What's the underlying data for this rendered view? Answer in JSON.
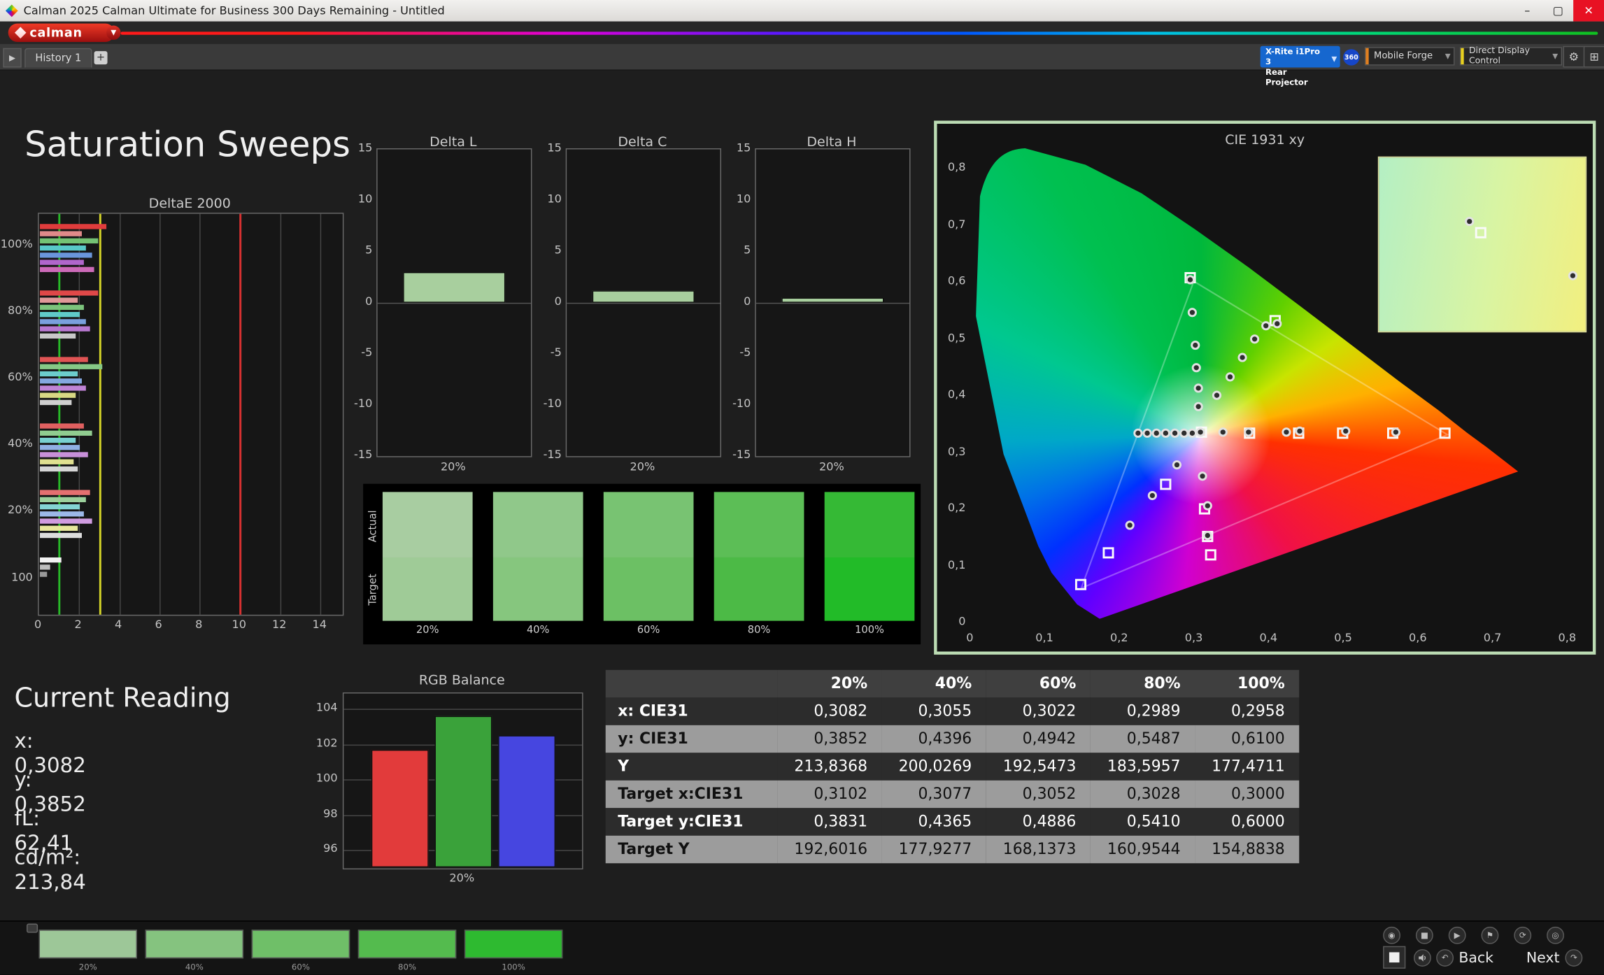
{
  "window": {
    "title": "Calman 2025 Calman Ultimate for Business 300 Days Remaining  - Untitled",
    "controls": {
      "minimize": "–",
      "maximize": "▢",
      "close": "✕"
    }
  },
  "brand": {
    "logo_text": "calman",
    "caret": "▼"
  },
  "toolbar": {
    "panel_toggle": "▶",
    "history_tab": "History 1",
    "add_tab": "+",
    "meter_line1": "X-Rite i1Pro 3",
    "meter_line2": "Rear Projector",
    "meter_caret": "▼",
    "badge": "360",
    "source_button": "Mobile Forge",
    "control_button": "Direct Display Control",
    "caret": "▼",
    "gear_glyph": "⚙",
    "layout_glyph": "⊞",
    "source_stripe_color": "#e08020",
    "control_stripe_color": "#e8d020"
  },
  "page": {
    "title": "Saturation Sweeps"
  },
  "chart_data": [
    {
      "type": "bar",
      "title": "DeltaE 2000",
      "orientation": "horizontal",
      "xlim": [
        0,
        15.1
      ],
      "x_ticks": [
        0,
        2,
        4,
        6,
        8,
        10,
        12,
        14
      ],
      "ref_lines": [
        {
          "color": "#28b828",
          "value": 1
        },
        {
          "color": "#d4d428",
          "value": 3.05
        },
        {
          "color": "#d83030",
          "value": 10
        }
      ],
      "groups": [
        {
          "label": "100%",
          "bars": [
            [
              "#e03c3c",
              3.3
            ],
            [
              "#e08a8a",
              2.1
            ],
            [
              "#74c274",
              2.9
            ],
            [
              "#58c8c8",
              2.3
            ],
            [
              "#6a96dc",
              2.6
            ],
            [
              "#b066cc",
              2.2
            ],
            [
              "#cc6ab8",
              2.7
            ]
          ]
        },
        {
          "label": "80%",
          "bars": [
            [
              "#e04848",
              2.9
            ],
            [
              "#e09898",
              1.9
            ],
            [
              "#7cc47c",
              2.2
            ],
            [
              "#60caca",
              2.0
            ],
            [
              "#7aa0de",
              2.3
            ],
            [
              "#b878d0",
              2.5
            ],
            [
              "#c8c8c8",
              1.8
            ]
          ]
        },
        {
          "label": "60%",
          "bars": [
            [
              "#e05454",
              2.4
            ],
            [
              "#86c886",
              3.1
            ],
            [
              "#6ccccc",
              1.9
            ],
            [
              "#84a8e0",
              2.1
            ],
            [
              "#c084d6",
              2.3
            ],
            [
              "#d8d884",
              1.8
            ],
            [
              "#cfcfcf",
              1.6
            ]
          ]
        },
        {
          "label": "40%",
          "bars": [
            [
              "#e06060",
              2.2
            ],
            [
              "#90cc90",
              2.6
            ],
            [
              "#78d0d0",
              1.8
            ],
            [
              "#90b0e4",
              2.0
            ],
            [
              "#c890da",
              2.4
            ],
            [
              "#e0e090",
              1.7
            ],
            [
              "#d6d6d6",
              1.9
            ]
          ]
        },
        {
          "label": "20%",
          "bars": [
            [
              "#e47070",
              2.5
            ],
            [
              "#9cd09c",
              2.3
            ],
            [
              "#84d4d4",
              2.0
            ],
            [
              "#9cb8e8",
              2.2
            ],
            [
              "#d09ce0",
              2.6
            ],
            [
              "#e8e89c",
              1.9
            ],
            [
              "#dddddd",
              2.1
            ]
          ]
        },
        {
          "label": "100",
          "bars": [
            [
              "#f2f2f2",
              1.05
            ],
            [
              "#bcbcbc",
              0.5
            ],
            [
              "#9a9a9a",
              0.35
            ]
          ]
        }
      ]
    },
    {
      "type": "bar",
      "title": "Delta L",
      "categories": [
        "20%"
      ],
      "values": [
        3.0
      ],
      "ylim": [
        -15,
        15
      ],
      "y_ticks": [
        15,
        10,
        5,
        0,
        -5,
        -10,
        -15
      ]
    },
    {
      "type": "bar",
      "title": "Delta C",
      "categories": [
        "20%"
      ],
      "values": [
        1.2
      ],
      "ylim": [
        -15,
        15
      ],
      "y_ticks": [
        15,
        10,
        5,
        0,
        -5,
        -10,
        -15
      ]
    },
    {
      "type": "bar",
      "title": "Delta H",
      "categories": [
        "20%"
      ],
      "values": [
        0.5
      ],
      "ylim": [
        -15,
        15
      ],
      "y_ticks": [
        15,
        10,
        5,
        0,
        -5,
        -10,
        -15
      ]
    },
    {
      "type": "scatter",
      "title": "CIE 1931 xy",
      "x_ticks": [
        "0",
        "0,1",
        "0,2",
        "0,3",
        "0,4",
        "0,5",
        "0,6",
        "0,7",
        "0,8"
      ],
      "y_ticks": [
        "0",
        "0,1",
        "0,2",
        "0,3",
        "0,4",
        "0,5",
        "0,6",
        "0,7",
        "0,8"
      ],
      "xlim": [
        0,
        0.8
      ],
      "ylim": [
        0,
        0.8
      ],
      "measured_points": [
        [
          0.225,
          0.333
        ],
        [
          0.2375,
          0.333
        ],
        [
          0.25,
          0.333
        ],
        [
          0.2625,
          0.333
        ],
        [
          0.275,
          0.333
        ],
        [
          0.2875,
          0.333
        ],
        [
          0.2985,
          0.333
        ],
        [
          0.309,
          0.3335
        ],
        [
          0.3395,
          0.334
        ],
        [
          0.3735,
          0.3345
        ],
        [
          0.4245,
          0.335
        ],
        [
          0.4415,
          0.3355
        ],
        [
          0.503,
          0.336
        ],
        [
          0.5705,
          0.3345
        ],
        [
          0.3065,
          0.379
        ],
        [
          0.3055,
          0.412
        ],
        [
          0.3035,
          0.447
        ],
        [
          0.3015,
          0.488
        ],
        [
          0.2985,
          0.545
        ],
        [
          0.2955,
          0.602
        ],
        [
          0.331,
          0.399
        ],
        [
          0.349,
          0.432
        ],
        [
          0.365,
          0.465
        ],
        [
          0.381,
          0.498
        ],
        [
          0.396,
          0.522
        ],
        [
          0.412,
          0.525
        ],
        [
          0.278,
          0.276
        ],
        [
          0.245,
          0.222
        ],
        [
          0.214,
          0.171
        ],
        [
          0.312,
          0.256
        ],
        [
          0.318,
          0.205
        ],
        [
          0.319,
          0.153
        ]
      ],
      "target_points": [
        [
          0.31,
          0.334
        ],
        [
          0.374,
          0.332
        ],
        [
          0.441,
          0.333
        ],
        [
          0.499,
          0.333
        ],
        [
          0.566,
          0.333
        ],
        [
          0.636,
          0.333
        ],
        [
          0.2955,
          0.607
        ],
        [
          0.409,
          0.53
        ],
        [
          0.262,
          0.243
        ],
        [
          0.185,
          0.121
        ],
        [
          0.149,
          0.065
        ],
        [
          0.315,
          0.2
        ],
        [
          0.319,
          0.15
        ],
        [
          0.322,
          0.118
        ]
      ],
      "inset_markers": [
        {
          "type": "circle",
          "x_pct": 44,
          "y_pct": 37
        },
        {
          "type": "square",
          "x_pct": 49,
          "y_pct": 43
        },
        {
          "type": "circle",
          "x_pct": 94,
          "y_pct": 68
        }
      ]
    },
    {
      "type": "bar",
      "title": "RGB Balance",
      "categories": [
        "20%"
      ],
      "series": [
        {
          "name": "Red",
          "color": "#e23b3b",
          "values": [
            101.7
          ]
        },
        {
          "name": "Green",
          "color": "#3aa23a",
          "values": [
            103.6
          ]
        },
        {
          "name": "Blue",
          "color": "#4646e0",
          "values": [
            102.5
          ]
        }
      ],
      "ylim": [
        96,
        104
      ],
      "y_ticks": [
        104,
        102,
        100,
        98,
        96
      ]
    }
  ],
  "swatch_panel": {
    "row_labels": [
      "Actual",
      "Target"
    ],
    "columns": [
      {
        "label": "20%",
        "actual": "#a8cda1",
        "target": "#9fcb97"
      },
      {
        "label": "40%",
        "actual": "#90c88a",
        "target": "#86c67e"
      },
      {
        "label": "60%",
        "actual": "#78c372",
        "target": "#6cc064"
      },
      {
        "label": "80%",
        "actual": "#5cbe56",
        "target": "#4cba46"
      },
      {
        "label": "100%",
        "actual": "#35b935",
        "target": "#22bb28"
      }
    ]
  },
  "current_reading": {
    "title": "Current Reading",
    "lines": [
      "x: 0,3082",
      "y: 0,3852",
      "fL: 62,41",
      "cd/m²: 213,84"
    ]
  },
  "results_table": {
    "columns": [
      "",
      "20%",
      "40%",
      "60%",
      "80%",
      "100%"
    ],
    "rows": [
      {
        "label": "x: CIE31",
        "values": [
          "0,3082",
          "0,3055",
          "0,3022",
          "0,2989",
          "0,2958"
        ]
      },
      {
        "label": "y: CIE31",
        "values": [
          "0,3852",
          "0,4396",
          "0,4942",
          "0,5487",
          "0,6100"
        ]
      },
      {
        "label": "Y",
        "values": [
          "213,8368",
          "200,0269",
          "192,5473",
          "183,5957",
          "177,4711"
        ]
      },
      {
        "label": "Target x:CIE31",
        "values": [
          "0,3102",
          "0,3077",
          "0,3052",
          "0,3028",
          "0,3000"
        ]
      },
      {
        "label": "Target y:CIE31",
        "values": [
          "0,3831",
          "0,4365",
          "0,4886",
          "0,5410",
          "0,6000"
        ]
      },
      {
        "label": "Target Y",
        "values": [
          "192,6016",
          "177,9277",
          "168,1373",
          "160,9544",
          "154,8838"
        ]
      }
    ]
  },
  "bottom": {
    "pattern_swatches": [
      {
        "label": "20%",
        "color": "#9dc798"
      },
      {
        "label": "40%",
        "color": "#85c37f"
      },
      {
        "label": "60%",
        "color": "#6fbf68"
      },
      {
        "label": "80%",
        "color": "#54bb4e"
      },
      {
        "label": "100%",
        "color": "#2eba30"
      }
    ],
    "transport_buttons": [
      {
        "name": "read-continuous-button",
        "glyph": "◉"
      },
      {
        "name": "stop-button",
        "glyph": "■"
      },
      {
        "name": "play-button",
        "glyph": "▶"
      },
      {
        "name": "flag-button",
        "glyph": "⚑"
      },
      {
        "name": "refresh-button",
        "glyph": "⟳"
      },
      {
        "name": "power-button",
        "glyph": "◎"
      }
    ],
    "back_icon": "↶",
    "next_icon": "↷",
    "back_label": "Back",
    "next_label": "Next"
  }
}
